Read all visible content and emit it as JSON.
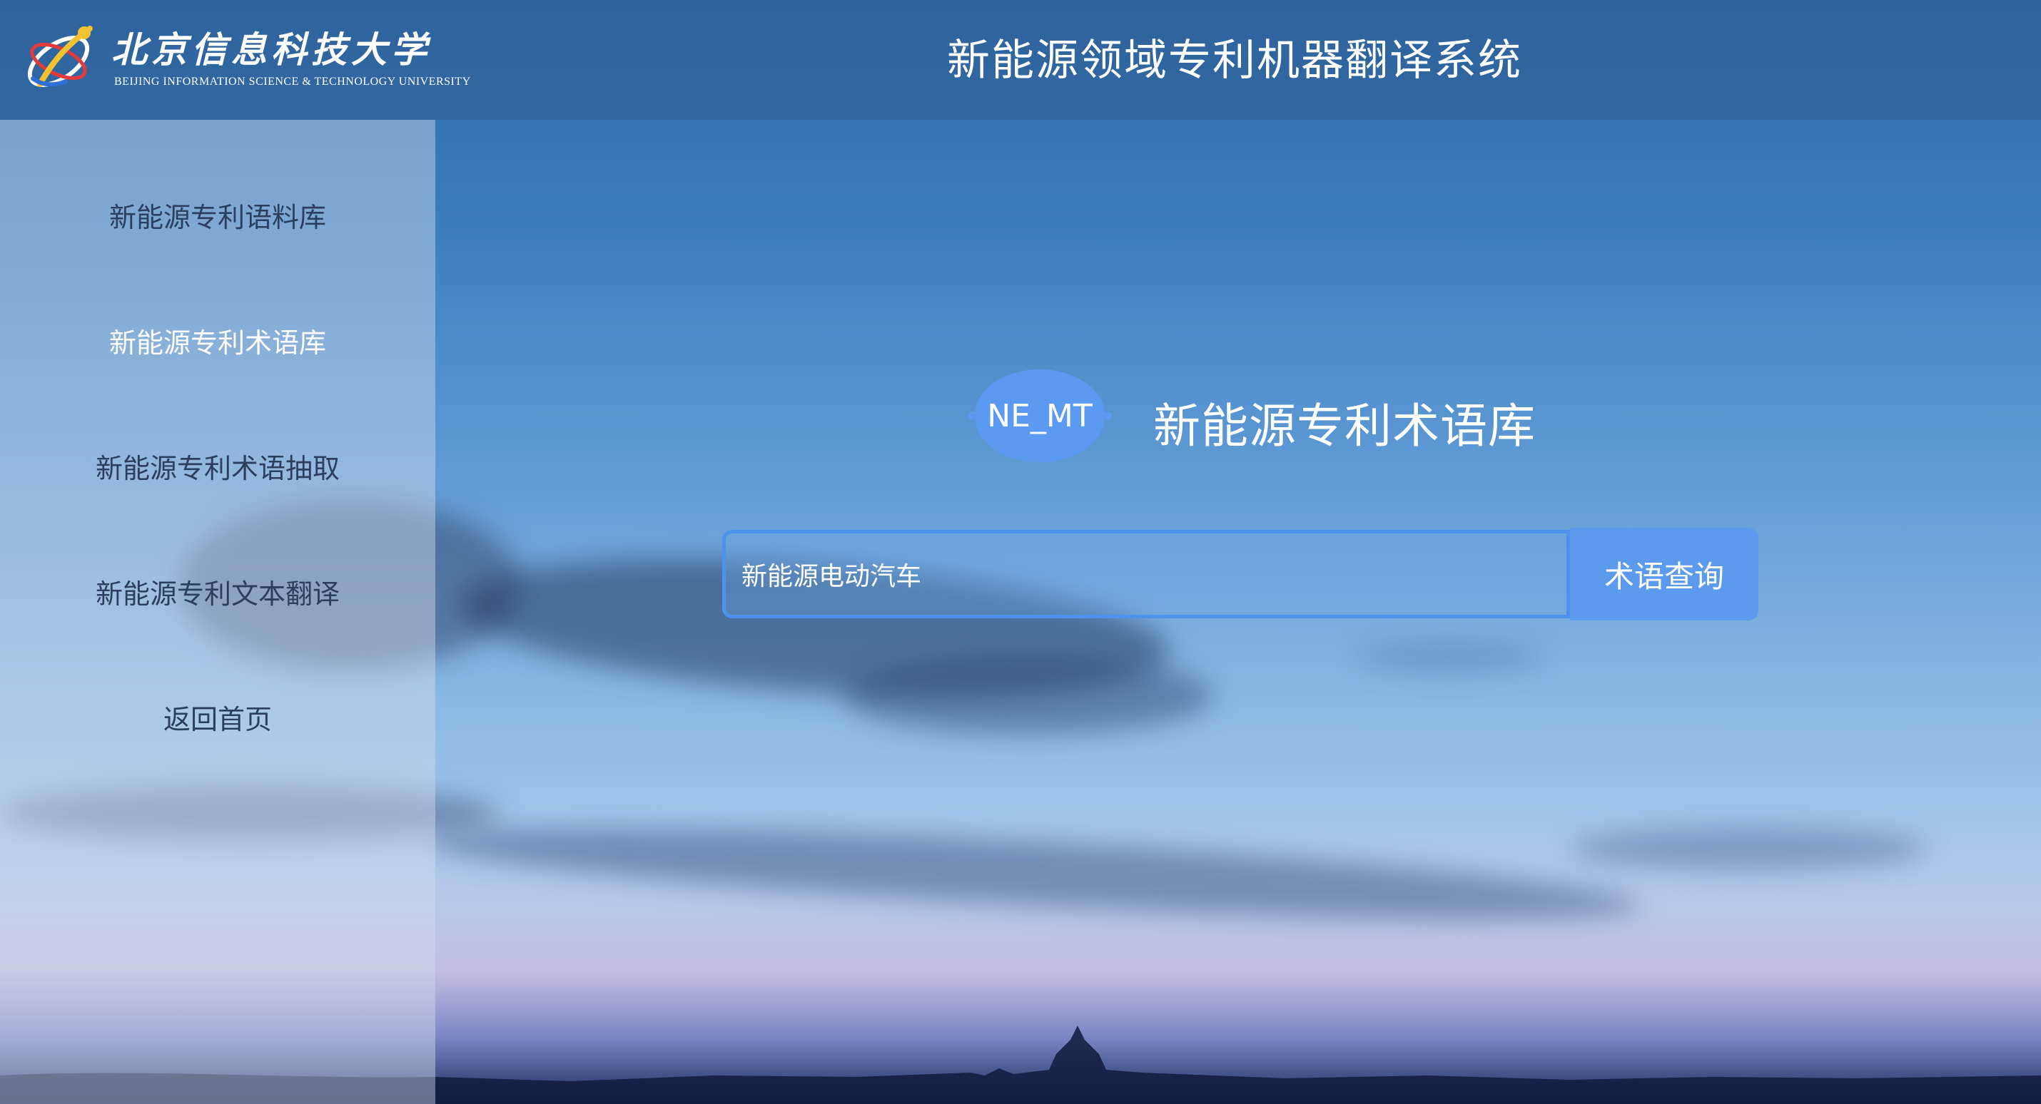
{
  "header": {
    "university_name_cn": "北京信息科技大学",
    "university_name_en": "BEIJING INFORMATION SCIENCE & TECHNOLOGY UNIVERSITY",
    "app_title": "新能源领域专利机器翻译系统"
  },
  "sidebar": {
    "items": [
      {
        "label": "新能源专利语料库",
        "active": false
      },
      {
        "label": "新能源专利术语库",
        "active": true
      },
      {
        "label": "新能源专利术语抽取",
        "active": false
      },
      {
        "label": "新能源专利文本翻译",
        "active": false
      },
      {
        "label": "返回首页",
        "active": false
      }
    ]
  },
  "main": {
    "badge_text": "NE_MT",
    "title": "新能源专利术语库",
    "search": {
      "value": "新能源电动汽车",
      "placeholder": ""
    },
    "search_button_label": "术语查询"
  },
  "colors": {
    "accent": "#5c9aed",
    "input_border": "#4d92ec",
    "badge_fill": "#5b9af0",
    "sidebar_text": "#2b3e5e",
    "sidebar_active_text": "#ffffff"
  },
  "icons": {
    "logo": "university-logo-icon"
  }
}
